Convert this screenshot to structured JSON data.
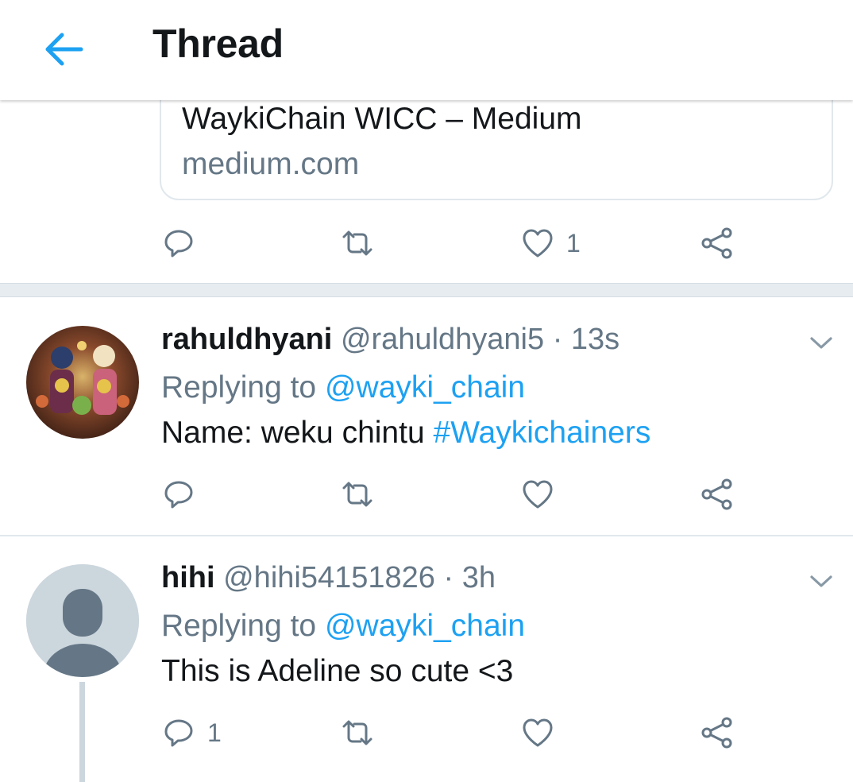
{
  "header": {
    "title": "Thread",
    "back_icon": "arrow-left-icon",
    "accent": "#1da1f2"
  },
  "link_card": {
    "title": "WaykiChain WICC – Medium",
    "domain": "medium.com"
  },
  "original_tweet_actions": {
    "reply_count": "",
    "retweet_count": "",
    "like_count": "1"
  },
  "replies": [
    {
      "display_name": "rahuldhyani",
      "handle": "@rahuldhyani5",
      "separator": "·",
      "time": "13s",
      "replying_prefix": "Replying to",
      "replying_to": "@wayki_chain",
      "text": "Name: weku chintu",
      "hashtag": "#Waykichainers",
      "reply_count": "",
      "like_count": ""
    },
    {
      "display_name": "hihi",
      "handle": "@hihi54151826",
      "separator": "·",
      "time": "3h",
      "replying_prefix": "Replying to",
      "replying_to": "@wayki_chain",
      "text": "This is Adeline so cute <3",
      "reply_count": "1",
      "like_count": ""
    }
  ],
  "colors": {
    "text": "#14171a",
    "secondary": "#657786",
    "link": "#1da1f2",
    "divider": "#e6ecf0"
  }
}
